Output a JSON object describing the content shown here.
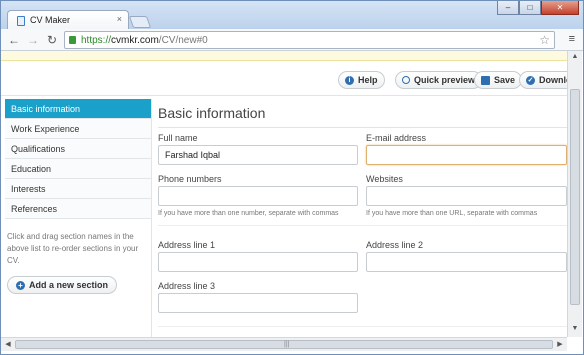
{
  "browser": {
    "tab_title": "CV Maker",
    "tab_close": "×",
    "url_scheme": "https://",
    "url_host": "cvmkr.com",
    "url_path": "/CV/new#0",
    "back_glyph": "←",
    "forward_glyph": "→",
    "reload_glyph": "↻",
    "star_glyph": "☆",
    "menu_glyph": "≡",
    "min_glyph": "–",
    "max_glyph": "□",
    "close_glyph": "✕"
  },
  "actions": {
    "help": "Help",
    "preview": "Quick preview",
    "save": "Save",
    "download": "Downlo"
  },
  "sidebar": {
    "items": [
      {
        "label": "Basic information"
      },
      {
        "label": "Work Experience"
      },
      {
        "label": "Qualifications"
      },
      {
        "label": "Education"
      },
      {
        "label": "Interests"
      },
      {
        "label": "References"
      }
    ],
    "help_text": "Click and drag section names in the above list to re-order sections in your CV.",
    "add_section": "Add a new section"
  },
  "form": {
    "title": "Basic information",
    "full_name_label": "Full name",
    "full_name_value": "Farshad Iqbal",
    "email_label": "E-mail address",
    "email_value": "",
    "phone_label": "Phone numbers",
    "phone_hint": "If you have more than one number, separate with commas",
    "websites_label": "Websites",
    "websites_hint": "If you have more than one URL, separate with commas",
    "address1_label": "Address line 1",
    "address2_label": "Address line 2",
    "address3_label": "Address line 3"
  },
  "colors": {
    "accent": "#1aa0c9",
    "focus_border": "#e0b070"
  }
}
